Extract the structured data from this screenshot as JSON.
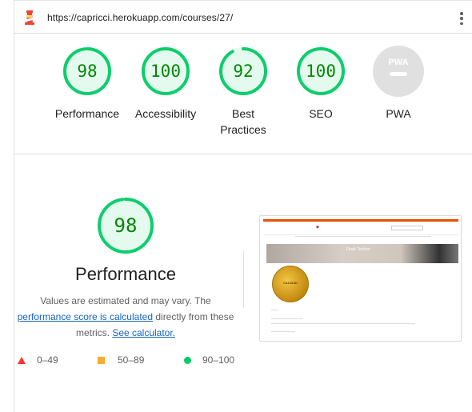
{
  "url": "https://capricci.herokuapp.com/courses/27/",
  "colors": {
    "pass": "#0cce6b",
    "pass_text": "#008800",
    "pwa_gray": "#e0e0e0",
    "link": "#1565c0"
  },
  "summary": [
    {
      "label": "Performance",
      "score": "98",
      "fraction": 0.98
    },
    {
      "label": "Accessibility",
      "score": "100",
      "fraction": 1.0
    },
    {
      "label": "Best Practices",
      "score": "92",
      "fraction": 0.92
    },
    {
      "label": "SEO",
      "score": "100",
      "fraction": 1.0
    },
    {
      "label": "PWA",
      "score": "",
      "fraction": 0
    }
  ],
  "pwa_badge": "PWA",
  "performance": {
    "score": "98",
    "fraction": 0.98,
    "title": "Performance",
    "desc_1": "Values are estimated and may vary. The",
    "calc_link": "performance score is calculated",
    "desc_2": " directly from these",
    "desc_3": "metrics. ",
    "see_calc": "See calculator."
  },
  "legend": {
    "fail": "0–49",
    "average": "50–89",
    "pass": "90–100"
  },
  "thumbnail": {
    "banner_title": "Final: Techno",
    "badge_text": "CALIDAD"
  },
  "icons": {
    "logo": "lighthouse-icon",
    "menu": "kebab-menu-icon"
  }
}
